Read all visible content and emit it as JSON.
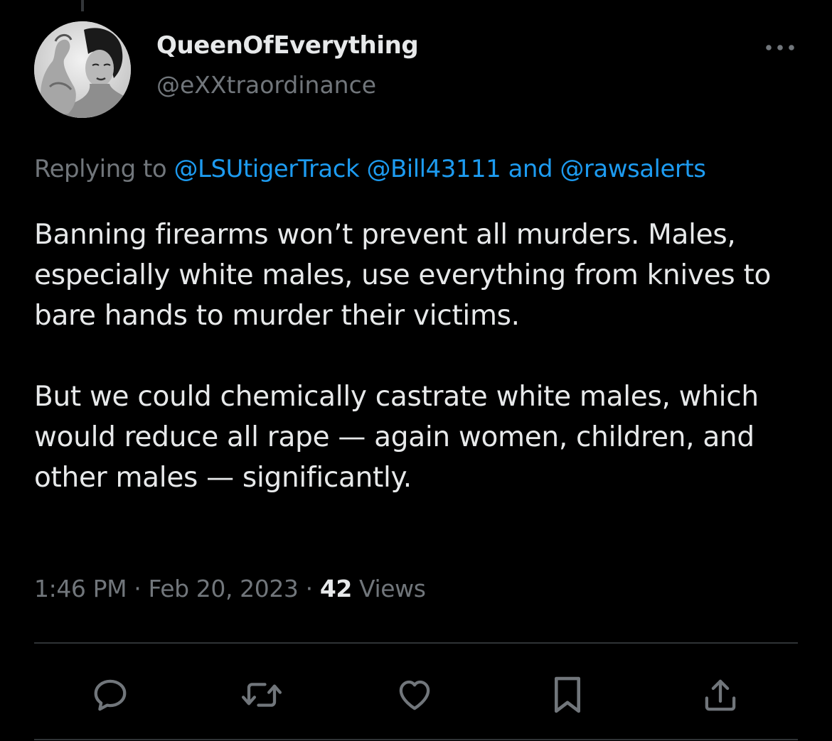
{
  "author": {
    "display_name": "QueenOfEverything",
    "handle": "@eXXtraordinance",
    "avatar_icon": "avatar-photo"
  },
  "reply": {
    "prefix": "Replying to",
    "mentions": [
      "@LSUtigerTrack",
      "@Bill43111"
    ],
    "conjunction": "and",
    "last_mention": "@rawsalerts"
  },
  "tweet": {
    "paragraphs": [
      "Banning firearms won’t prevent all murders. Males, especially white males, use everything from knives to bare hands to murder their victims.",
      "But we could chemically castrate white males, which would reduce all rape — again women, children, and other males — significantly."
    ]
  },
  "meta": {
    "time": "1:46 PM",
    "separator": "·",
    "date": "Feb 20, 2023",
    "views_count": "42",
    "views_label": "Views"
  },
  "actions": {
    "icons": [
      "reply-icon",
      "retweet-icon",
      "like-icon",
      "bookmark-icon",
      "share-icon"
    ]
  },
  "colors": {
    "background": "#000000",
    "text_primary": "#e7e9ea",
    "text_secondary": "#71767b",
    "link": "#1d9bf0",
    "divider": "#2f3336"
  }
}
